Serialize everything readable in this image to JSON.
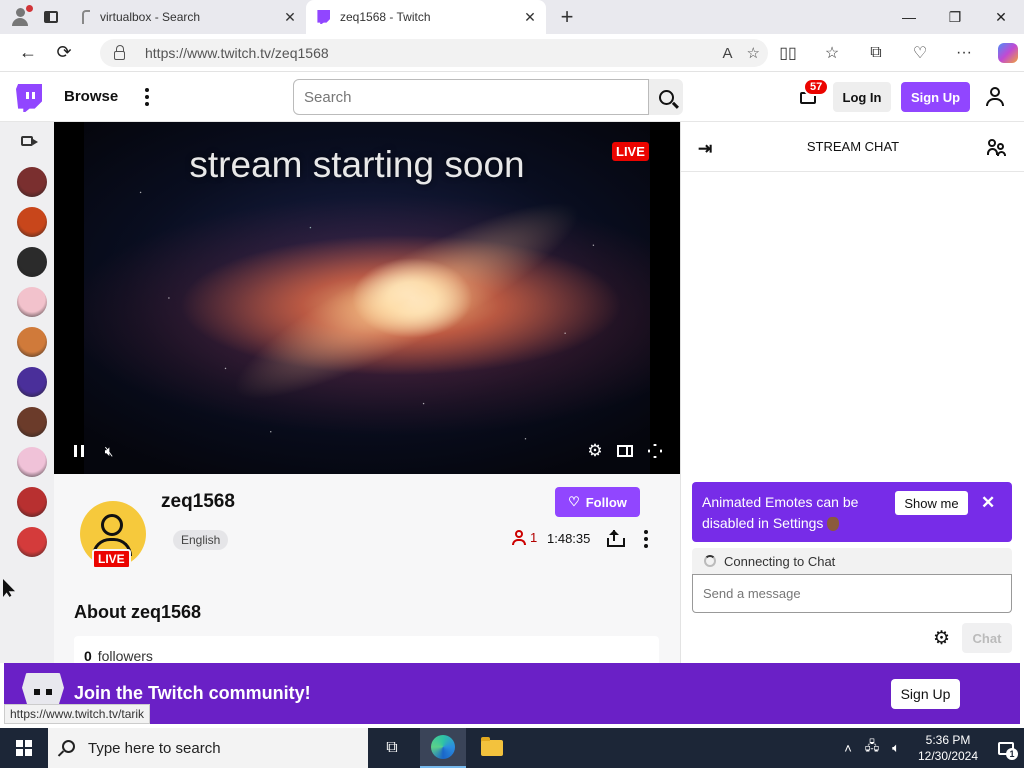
{
  "browser": {
    "tabs": [
      {
        "title": "virtualbox - Search",
        "active": false
      },
      {
        "title": "zeq1568 - Twitch",
        "active": true
      }
    ],
    "address": "https://www.twitch.tv/zeq1568",
    "status_url": "https://www.twitch.tv/tarik"
  },
  "header": {
    "browse_label": "Browse",
    "search_placeholder": "Search",
    "inbox_count": "57",
    "login_label": "Log In",
    "signup_label": "Sign Up"
  },
  "sidebar": {
    "avatar_colors": [
      "#7a2f2f",
      "#c8461b",
      "#2b2b2b",
      "#f2c2cc",
      "#d07a3a",
      "#4a2f9a",
      "#6b3b2a",
      "#f0c2d8",
      "#b83030",
      "#d43b3b"
    ]
  },
  "video": {
    "overlay_text": "stream starting soon",
    "live_label": "LIVE"
  },
  "channel": {
    "name": "zeq1568",
    "live_label": "LIVE",
    "language_tag": "English",
    "follow_label": "Follow",
    "viewer_count": "1",
    "uptime": "1:48:35",
    "about_title": "About zeq1568",
    "followers_count": "0",
    "followers_label": "followers"
  },
  "chat": {
    "title": "STREAM CHAT",
    "banner_text": "Animated Emotes can be disabled in Settings",
    "show_me_label": "Show me",
    "connecting_text": "Connecting to Chat",
    "message_placeholder": "Send a message",
    "chat_button_label": "Chat"
  },
  "join_banner": {
    "text": "Join the Twitch community!",
    "signup_label": "Sign Up"
  },
  "taskbar": {
    "search_placeholder": "Type here to search",
    "time": "5:36 PM",
    "date": "12/30/2024",
    "notification_count": "1"
  },
  "colors": {
    "twitch_purple": "#9146ff",
    "live_red": "#eb0400",
    "banner_purple": "#6a20c6"
  }
}
